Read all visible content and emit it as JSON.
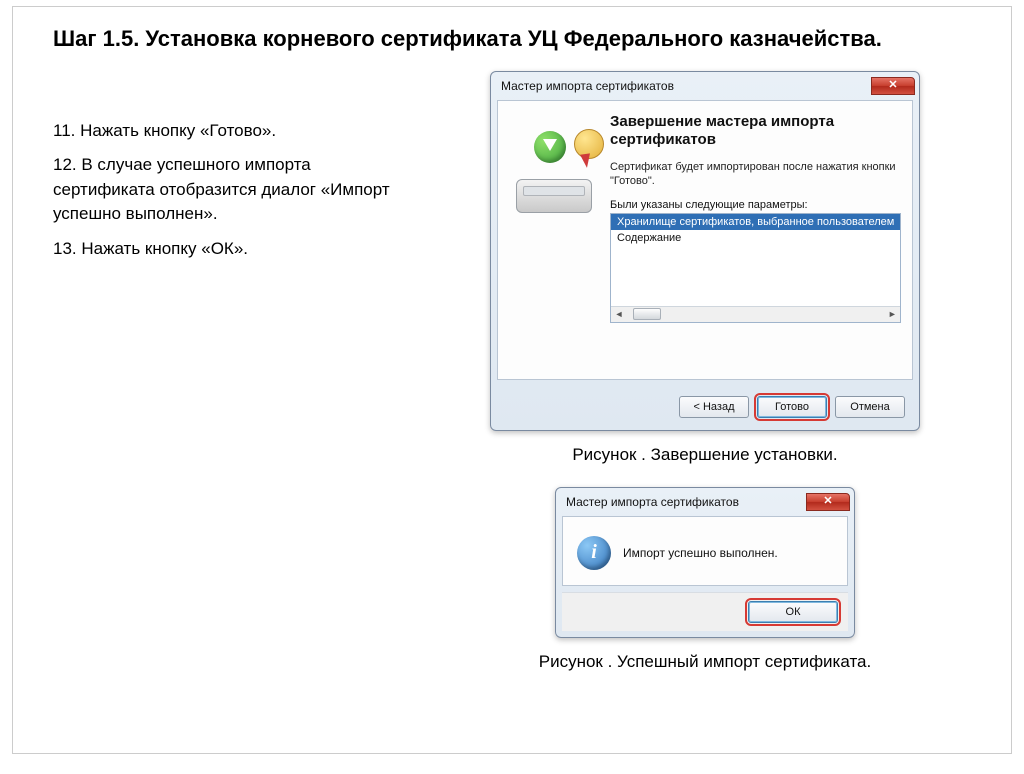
{
  "title": "Шаг 1.5. Установка корневого сертификата УЦ Федерального казначейства.",
  "steps": {
    "s11": "11. Нажать кнопку «Готово».",
    "s12": "12. В случае успешного импорта сертификата отобразится диалог «Импорт успешно выполнен».",
    "s13": "13. Нажать кнопку «ОК»."
  },
  "wizard": {
    "window_title": "Мастер импорта сертификатов",
    "heading": "Завершение мастера импорта сертификатов",
    "subtext": "Сертификат будет импортирован после нажатия кнопки \"Готово\".",
    "params_label": "Были указаны следующие параметры:",
    "rows": {
      "r0": "Хранилище сертификатов, выбранное пользователем",
      "r1": "Содержание"
    },
    "buttons": {
      "back": "< Назад",
      "finish": "Готово",
      "cancel": "Отмена"
    }
  },
  "caption1": "Рисунок . Завершение установки.",
  "msg": {
    "window_title": "Мастер импорта сертификатов",
    "text": "Импорт успешно выполнен.",
    "ok": "ОК"
  },
  "caption2": "Рисунок . Успешный импорт сертификата."
}
